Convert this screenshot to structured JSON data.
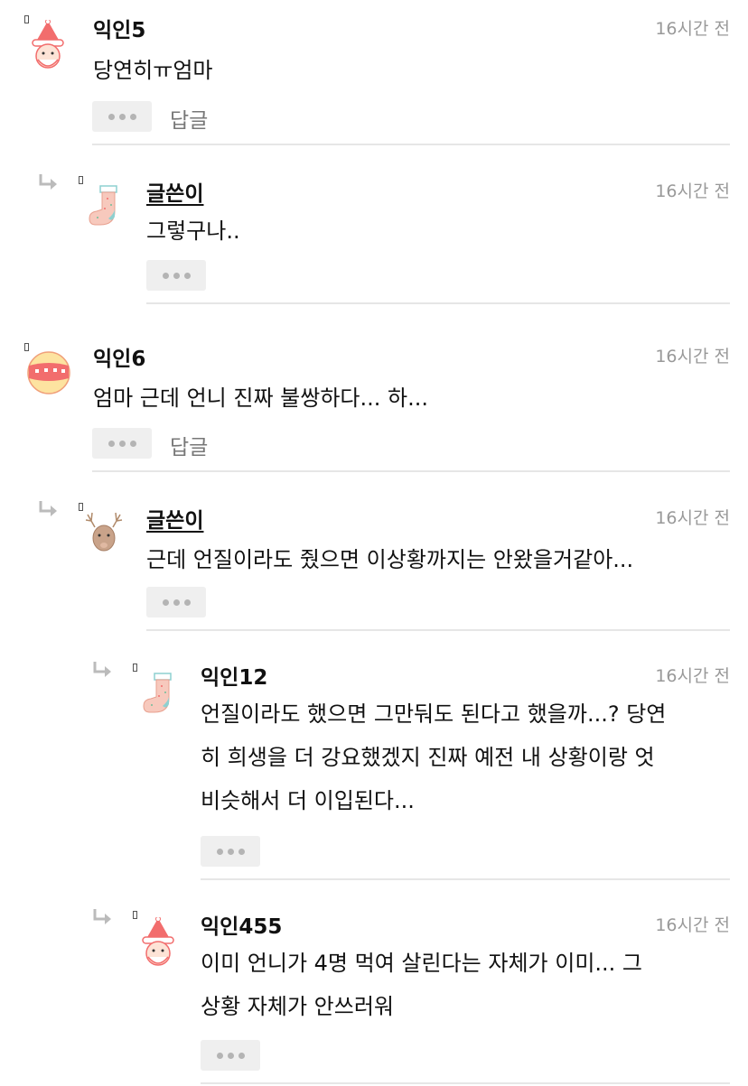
{
  "comments": [
    {
      "author": "익인5",
      "time": "16시간 전",
      "lines": [
        "당연히ㅠ엄마"
      ],
      "more": "•••",
      "reply": "답글",
      "avatar": "santa-icon"
    },
    {
      "author": "글쓴이",
      "time": "16시간 전",
      "lines": [
        "그렇구나.."
      ],
      "more": "•••",
      "avatar": "stocking-icon"
    },
    {
      "author": "익인6",
      "time": "16시간 전",
      "lines": [
        "엄마 근데 언니 진짜 불쌍하다... 하..."
      ],
      "more": "•••",
      "reply": "답글",
      "avatar": "ornament-icon"
    },
    {
      "author": "글쓴이",
      "time": "16시간 전",
      "lines": [
        "근데 언질이라도 줬으면 이상황까지는 안왔을거같아..."
      ],
      "more": "•••",
      "avatar": "reindeer-icon"
    },
    {
      "author": "익인12",
      "time": "16시간 전",
      "lines": [
        "언질이라도 했으면 그만둬도 된다고 했을까...? 당연",
        "히 희생을 더 강요했겠지 진짜 예전 내 상황이랑 엇",
        "비슷해서 더 이입된다..."
      ],
      "more": "•••",
      "avatar": "stocking-icon"
    },
    {
      "author": "익인455",
      "time": "16시간 전",
      "lines": [
        "이미 언니가 4명 먹여 살린다는 자체가 이미... 그",
        "상황 자체가 안쓰러워"
      ],
      "more": "•••",
      "avatar": "santa-icon"
    }
  ],
  "colors": {
    "accent_red": "#f26d6d",
    "skin": "#fde3d6",
    "time_gray": "#999999",
    "button_bg": "#efefef"
  }
}
